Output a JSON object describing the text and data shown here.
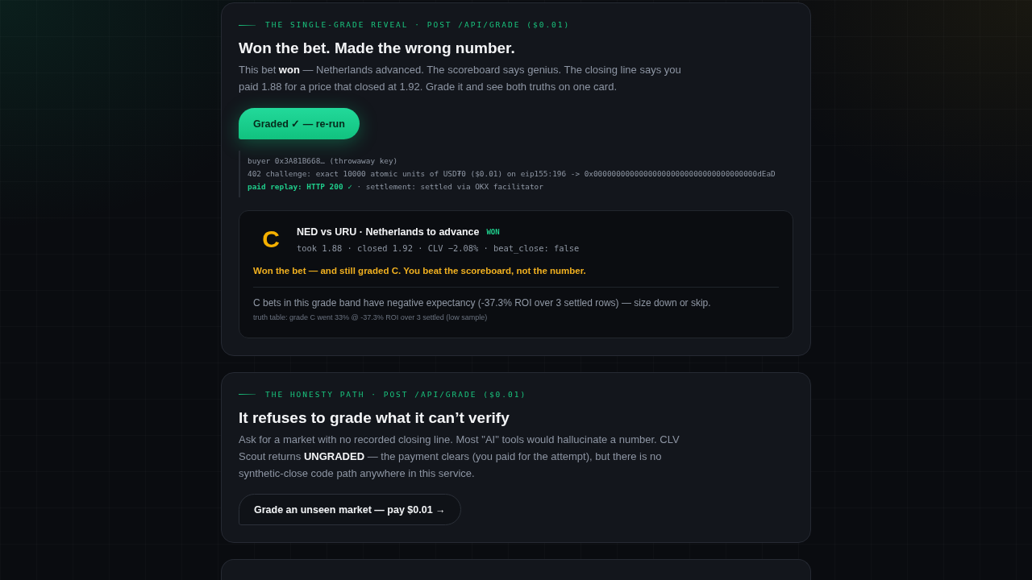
{
  "sections": [
    {
      "eyebrow": "THE SINGLE-GRADE REVEAL · POST /API/GRADE ($0.01)",
      "title": "Won the bet. Made the wrong number.",
      "body": "This bet **won** — Netherlands advanced. The scoreboard says genius. The closing line says you paid 1.88 for a price that closed at 1.92. Grade it and see both truths on one card.",
      "button": {
        "label": "Graded ✓ — re-run",
        "kind": "primary"
      },
      "log": [
        "buyer 0x3A81B668… (throwaway key)",
        "402 challenge: exact 10000 atomic units of USD₮0 ($0.01) on eip155:196 -> 0x000000000000000000000000000000000000dEaD",
        "**paid replay: HTTP 200 ✓** · settlement: settled via OKX facilitator"
      ],
      "result": {
        "grade": "C",
        "matchup": "NED vs URU · Netherlands to advance",
        "outcome": {
          "label": "WON",
          "kind": "won"
        },
        "meta": "took 1.88 · closed 1.92 · CLV −2.08% · beat_close: false",
        "verdict": "Won the bet — and still graded C. You beat the scoreboard, not the number.",
        "advice": "C bets in this grade band have negative expectancy (-37.3% ROI over 3 settled rows) — size down or skip.",
        "footnote": "truth table: grade C went 33% @ -37.3% ROI over 3 settled (low sample)"
      }
    },
    {
      "eyebrow": "THE HONESTY PATH · POST /API/GRADE ($0.01)",
      "title": "It refuses to grade what it can’t verify",
      "body": "Ask for a market with no recorded closing line. Most \"AI\" tools would hallucinate a number. CLV Scout returns **UNGRADED** — the payment clears (you paid for the attempt), but there is no synthetic-close code path anywhere in this service.",
      "button": {
        "label": "Grade an unseen market — pay $0.01 →",
        "kind": "secondary"
      }
    }
  ]
}
